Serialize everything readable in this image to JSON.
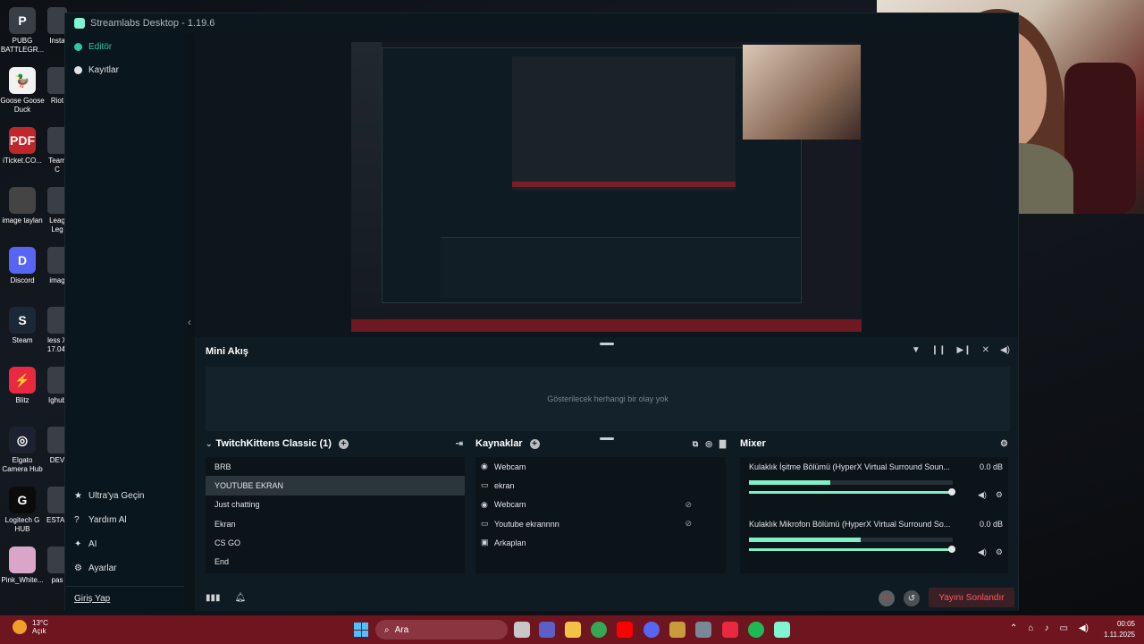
{
  "window": {
    "title": "Streamlabs Desktop - 1.19.6"
  },
  "desktop_icons": [
    {
      "label": "PUBG BATTLEGR...",
      "color": "#3a3f46",
      "glyph": "P"
    },
    {
      "label": "Goose Goose Duck",
      "color": "#f2f2f2",
      "glyph": "🦆"
    },
    {
      "label": "iTicket.CO...",
      "color": "#c0272d",
      "glyph": "PDF"
    },
    {
      "label": "image taylan",
      "color": "#444",
      "glyph": ""
    },
    {
      "label": "Discord",
      "color": "#5865f2",
      "glyph": "D"
    },
    {
      "label": "Steam",
      "color": "#1b2838",
      "glyph": "S"
    },
    {
      "label": "Blitz",
      "color": "#e8293f",
      "glyph": "⚡"
    },
    {
      "label": "Elgato Camera Hub",
      "color": "#1d2230",
      "glyph": "◎"
    },
    {
      "label": "Logitech G HUB",
      "color": "#0b0b0b",
      "glyph": "G"
    },
    {
      "label": "Pink_White...",
      "color": "#d9a6c8",
      "glyph": ""
    }
  ],
  "desktop_icons_col2": [
    {
      "label": "Insta"
    },
    {
      "label": "Riot"
    },
    {
      "label": "Team C"
    },
    {
      "label": "Leag Leg"
    },
    {
      "label": "imag"
    },
    {
      "label": "less X 17.04."
    },
    {
      "label": "Ighub"
    },
    {
      "label": "DEV"
    },
    {
      "label": "ESTA_"
    },
    {
      "label": "pas"
    }
  ],
  "sidebar": {
    "nav": [
      {
        "label": "Editör",
        "active": true
      },
      {
        "label": "Kayıtlar",
        "active": false
      }
    ],
    "bottom": [
      {
        "label": "Ultra'ya Geçin",
        "icon": "★"
      },
      {
        "label": "Yardım Al",
        "icon": "?"
      },
      {
        "label": "AI",
        "icon": "✦"
      },
      {
        "label": "Ayarlar",
        "icon": "⚙"
      }
    ],
    "login": "Giriş Yap"
  },
  "mini_feed": {
    "title": "Mini Akış",
    "empty_text": "Gösterilecek herhangi bir olay yok"
  },
  "scenes": {
    "title": "TwitchKittens Classic (1)",
    "items": [
      {
        "label": "BRB",
        "selected": false
      },
      {
        "label": "YOUTUBE EKRAN",
        "selected": true
      },
      {
        "label": "Just chatting",
        "selected": false
      },
      {
        "label": "Ekran",
        "selected": false
      },
      {
        "label": "CS GO",
        "selected": false
      },
      {
        "label": "End",
        "selected": false
      }
    ]
  },
  "sources": {
    "title": "Kaynaklar",
    "items": [
      {
        "label": "Webcam",
        "icon": "webcam",
        "hidden": false
      },
      {
        "label": "ekran",
        "icon": "monitor",
        "hidden": false
      },
      {
        "label": "Webcam",
        "icon": "webcam",
        "hidden": true
      },
      {
        "label": "Youtube ekrannnn",
        "icon": "monitor",
        "hidden": true
      },
      {
        "label": "Arkaplan",
        "icon": "image",
        "hidden": false
      }
    ]
  },
  "mixer": {
    "title": "Mixer",
    "channels": [
      {
        "name": "Kulaklık İşitme Bölümü (HyperX Virtual Surround Soun...",
        "db": "0.0 dB",
        "level": 0.4
      },
      {
        "name": "Kulaklık Mikrofon Bölümü (HyperX Virtual Surround So...",
        "db": "0.0 dB",
        "level": 0.55
      }
    ]
  },
  "footer": {
    "rec_label": "REC",
    "end_stream": "Yayını Sonlandır"
  },
  "taskbar": {
    "weather_temp": "13°C",
    "weather_desc": "Açık",
    "search_placeholder": "Ara",
    "time": "00:05",
    "date": "1.11.2025"
  },
  "colors": {
    "accent": "#31c3a2",
    "taskbar": "#6e1520",
    "end_stream": "#ff5a5f"
  }
}
